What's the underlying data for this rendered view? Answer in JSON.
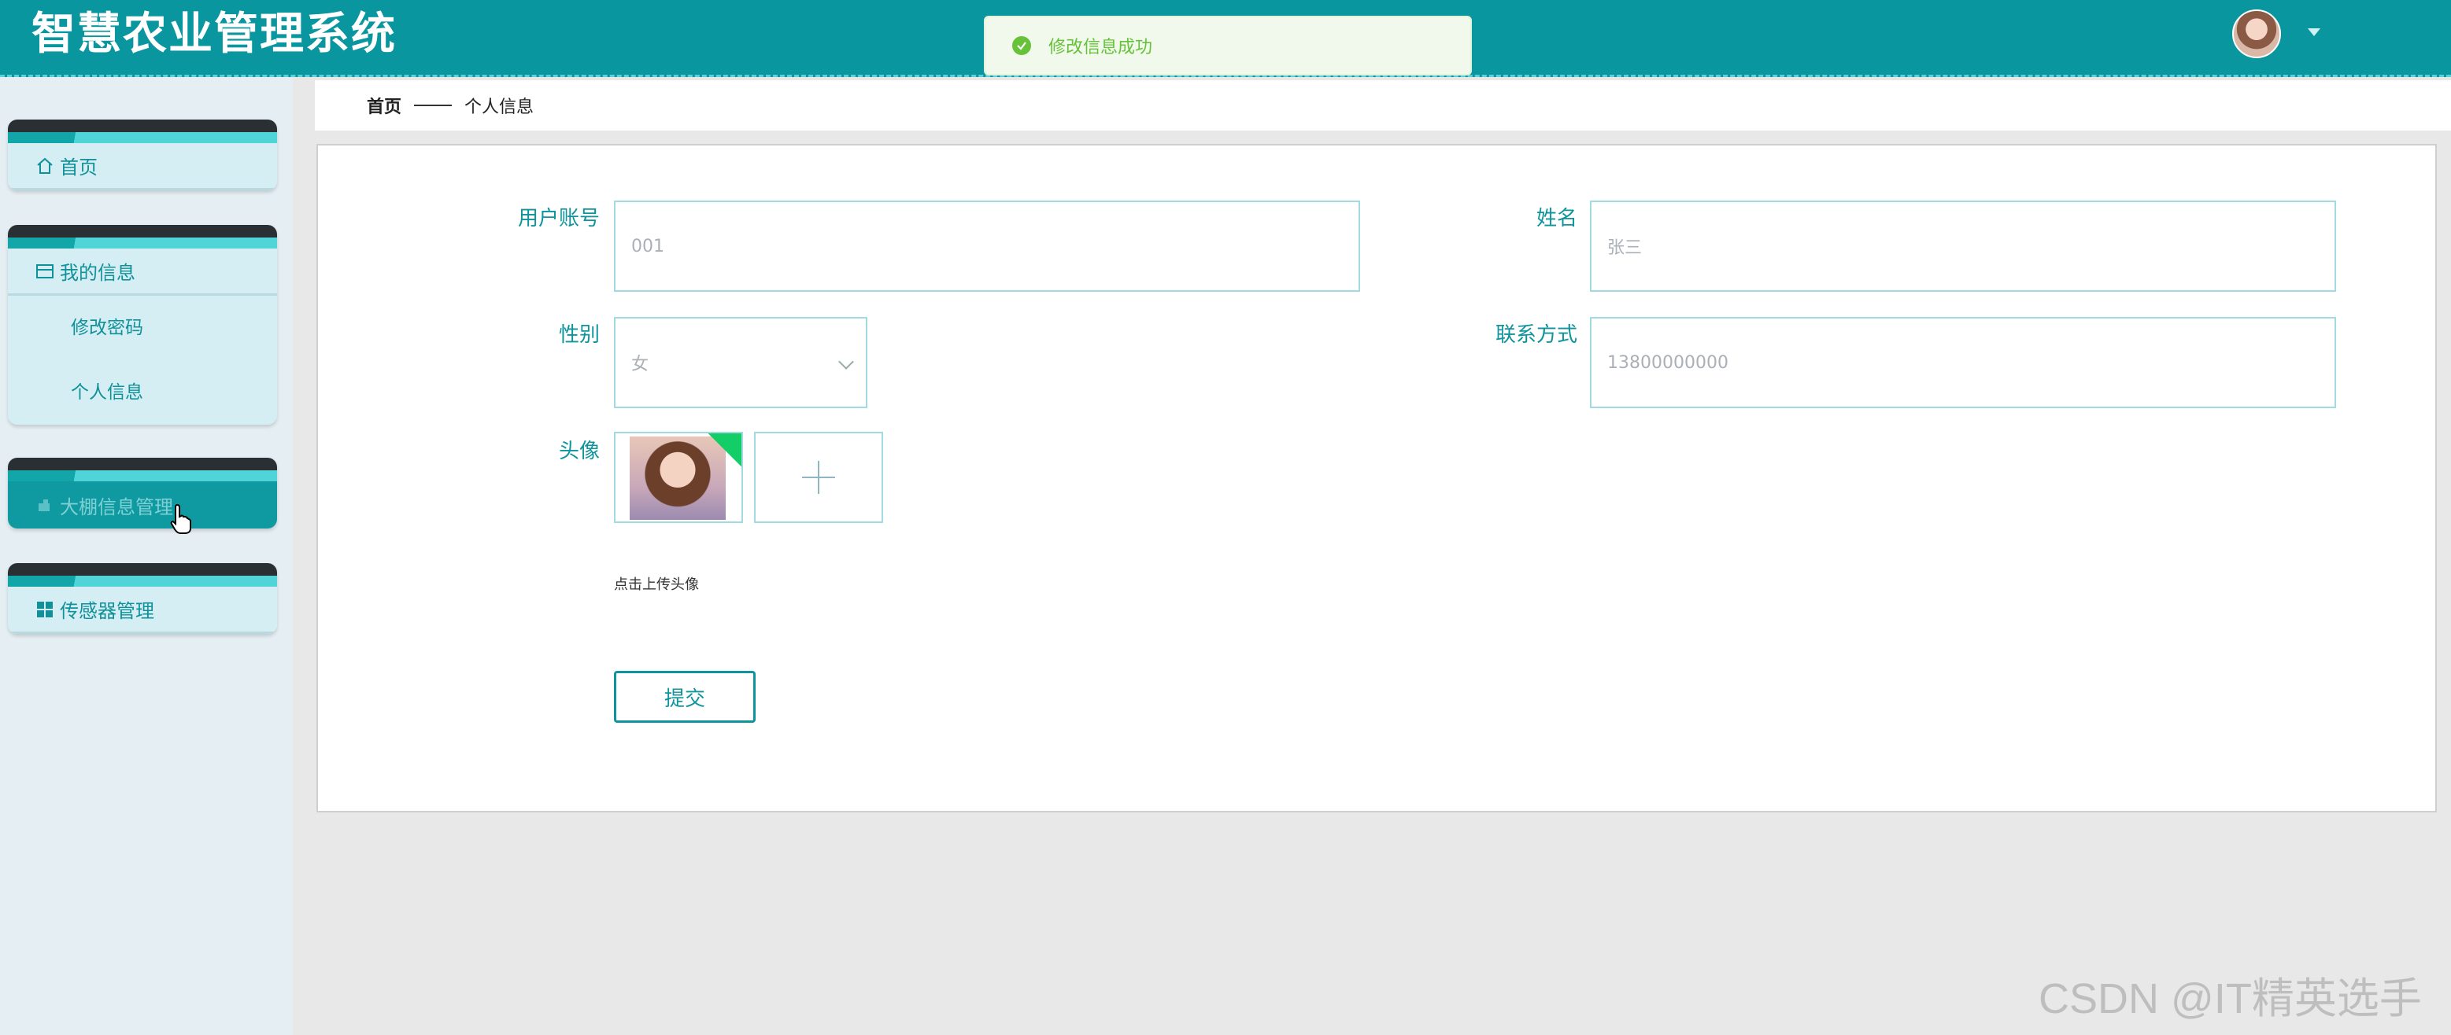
{
  "header": {
    "app_title": "智慧农业管理系统",
    "toast_message": "修改信息成功"
  },
  "sidebar": {
    "menus": [
      {
        "label": "首页",
        "icon": "home-icon"
      },
      {
        "label": "我的信息",
        "icon": "card-icon",
        "children": [
          "修改密码",
          "个人信息"
        ]
      },
      {
        "label": "大棚信息管理",
        "icon": "greenhouse-icon",
        "active": true
      },
      {
        "label": "传感器管理",
        "icon": "grid-icon"
      }
    ]
  },
  "breadcrumb": {
    "home": "首页",
    "current": "个人信息"
  },
  "form": {
    "account_label": "用户账号",
    "account_value": "001",
    "name_label": "姓名",
    "name_value": "张三",
    "gender_label": "性别",
    "gender_value": "女",
    "phone_label": "联系方式",
    "phone_value": "13800000000",
    "avatar_label": "头像",
    "upload_hint": "点击上传头像",
    "submit_label": "提交"
  },
  "watermark": "CSDN @IT精英选手",
  "colors": {
    "header_bg": "#0a969e",
    "accent": "#0e949c",
    "success": "#67c23a"
  }
}
